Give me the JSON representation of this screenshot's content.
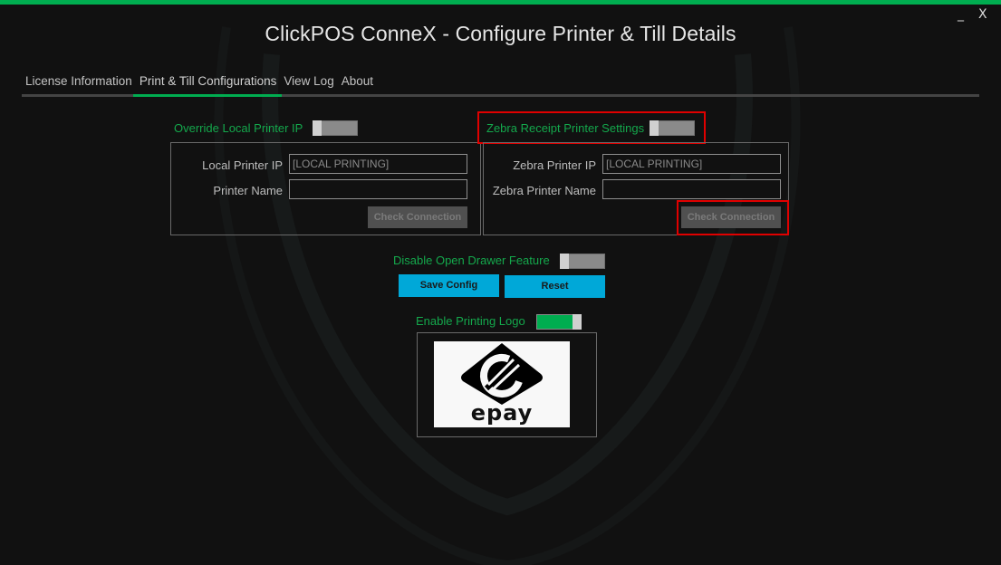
{
  "window": {
    "title": "ClickPOS ConneX - Configure Printer & Till Details",
    "minimize_label": "_",
    "close_label": "X",
    "accent_color": "#00ad50"
  },
  "tabs": [
    {
      "label": "License Information",
      "active": false
    },
    {
      "label": "Print & Till Configurations",
      "active": true
    },
    {
      "label": "View Log",
      "active": false
    },
    {
      "label": "About",
      "active": false
    }
  ],
  "local_printer": {
    "toggle_label": "Override Local Printer IP",
    "toggle_on": false,
    "ip_label": "Local Printer IP",
    "ip_value": "[LOCAL PRINTING]",
    "name_label": "Printer Name",
    "name_value": "",
    "check_button": "Check Connection"
  },
  "zebra_printer": {
    "toggle_label": "Zebra Receipt Printer Settings",
    "toggle_on": false,
    "ip_label": "Zebra Printer IP",
    "ip_value": "[LOCAL PRINTING]",
    "name_label": "Zebra Printer Name",
    "name_value": "",
    "check_button": "Check Connection"
  },
  "drawer": {
    "toggle_label": "Disable Open Drawer Feature",
    "toggle_on": false
  },
  "actions": {
    "save_label": "Save Config",
    "reset_label": "Reset",
    "button_color": "#00a8d8"
  },
  "logo": {
    "toggle_label": "Enable Printing Logo",
    "toggle_on": true,
    "image_text": "epay",
    "icon": "epay-logo"
  },
  "highlights": [
    "zebra-settings-toggle-group",
    "zebra-check-connection-button"
  ]
}
